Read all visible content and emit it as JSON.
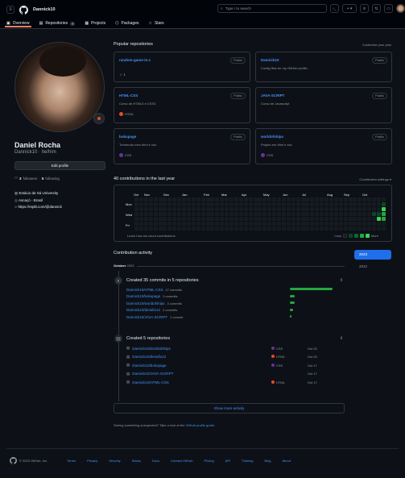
{
  "header": {
    "username": "Dannick10",
    "search_placeholder": "Type / to search"
  },
  "tabs": [
    {
      "label": "Overview"
    },
    {
      "label": "Repositories",
      "count": "7"
    },
    {
      "label": "Projects"
    },
    {
      "label": "Packages"
    },
    {
      "label": "Stars"
    }
  ],
  "profile": {
    "name": "Daniel Rocha",
    "handle": "Dannick10",
    "pronouns": "he/him",
    "edit_label": "Edit profile",
    "followers": "3",
    "followers_label": "followers",
    "following": "5",
    "following_label": "following",
    "org": "Estácio de Sá University",
    "location": "Ascaçó - Brasil",
    "link": "https://replit.com/@dannick"
  },
  "popular": {
    "title": "Popular repositories",
    "customize": "Customize your pins"
  },
  "repos": [
    {
      "name": "random-game-in-c",
      "desc": "",
      "lang": "",
      "color": "",
      "stars": "1",
      "badge": "Public"
    },
    {
      "name": "Dannick10",
      "desc": "Config files for my GitHub profile.",
      "lang": "",
      "color": "",
      "badge": "Public"
    },
    {
      "name": "HTML-CSS",
      "desc": "Curso de HTML5 e CSS3",
      "lang": "HTML",
      "color": "#e34c26",
      "badge": "Public"
    },
    {
      "name": "JAVA-SCRIPT",
      "desc": "Curso de Javascript",
      "lang": "",
      "color": "",
      "badge": "Public"
    },
    {
      "name": "bokupage",
      "desc": "Tremendo meu html e css",
      "lang": "CSS",
      "color": "#663399",
      "badge": "Public"
    },
    {
      "name": "worldofships",
      "desc": "Projeto em html e css",
      "lang": "CSS",
      "color": "#663399",
      "badge": "Public"
    }
  ],
  "contrib": {
    "title": "40 contributions in the last year",
    "settings": "Contribution settings ▾",
    "months": [
      "Oct",
      "Nov",
      "Dec",
      "Jan",
      "Feb",
      "Mar",
      "Apr",
      "May",
      "Jun",
      "Jul",
      "Aug",
      "Sep",
      "Oct"
    ],
    "days": [
      "Mon",
      "Wed",
      "Fri"
    ],
    "learn": "Learn how we count contributions",
    "less": "Less",
    "more": "More"
  },
  "activity": {
    "title": "Contribution activity",
    "month": "October",
    "year": "2023",
    "years": [
      "2023",
      "2022"
    ],
    "commits_title": "Created 35 commits in 5 repositories",
    "commits": [
      {
        "repo": "Dannick10/HTML-CSS",
        "count": "27 commits",
        "pct": 1.0
      },
      {
        "repo": "Dannick10/bokupage",
        "count": "3 commits",
        "pct": 0.12
      },
      {
        "repo": "Dannick10/worldofships",
        "count": "3 commits",
        "pct": 0.12
      },
      {
        "repo": "Dannick10/desafio12",
        "count": "2 commits",
        "pct": 0.08
      },
      {
        "repo": "Dannick10/JAVA-SCRIPT",
        "count": "1 commit",
        "pct": 0.04
      }
    ],
    "repos_title": "Created 5 repositories",
    "created": [
      {
        "repo": "Dannick10/worldofships",
        "lang": "CSS",
        "color": "#663399",
        "date": "Oct 20"
      },
      {
        "repo": "Dannick10/desafio12",
        "lang": "HTML",
        "color": "#e34c26",
        "date": "Oct 20"
      },
      {
        "repo": "Dannick10/bokupage",
        "lang": "CSS",
        "color": "#663399",
        "date": "Oct 17"
      },
      {
        "repo": "Dannick10/JAVA-SCRIPT",
        "lang": "",
        "color": "",
        "date": "Oct 17"
      },
      {
        "repo": "Dannick10/HTML-CSS",
        "lang": "HTML",
        "color": "#e34c26",
        "date": "Oct 17"
      }
    ],
    "more": "Show more activity",
    "feedback": "Seeing something unexpected? Take a look at the",
    "guide": "GitHub profile guide"
  },
  "footer": {
    "copy": "© 2023 GitHub, Inc.",
    "links": [
      "Terms",
      "Privacy",
      "Security",
      "Status",
      "Docs",
      "Contact GitHub",
      "Pricing",
      "API",
      "Training",
      "Blog",
      "About"
    ]
  }
}
